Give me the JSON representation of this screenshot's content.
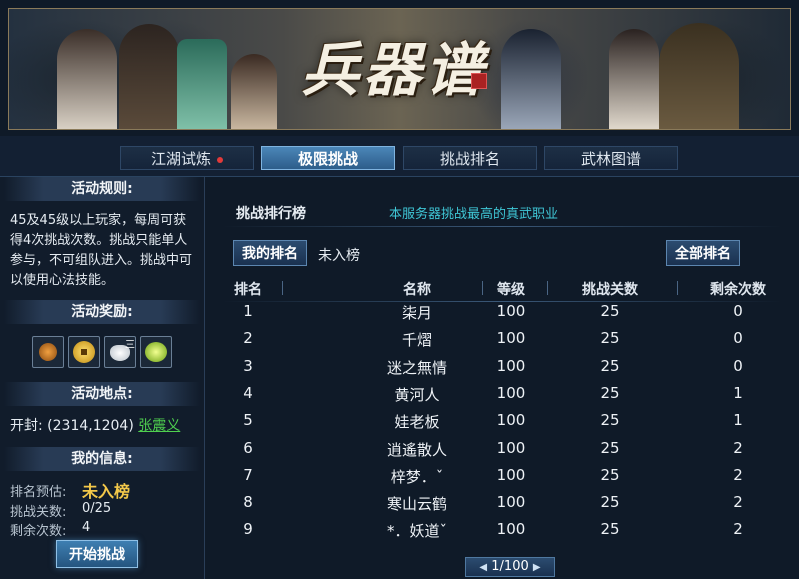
{
  "banner": {
    "title": "兵器谱"
  },
  "tabs": [
    {
      "label": "江湖试炼",
      "has_notice": true
    },
    {
      "label": "极限挑战",
      "active": true
    },
    {
      "label": "挑战排名"
    },
    {
      "label": "武林图谱"
    }
  ],
  "left": {
    "rules_title": "活动规则:",
    "rules_text": "45及45级以上玩家，每周可获得4次挑战次数。挑战只能单人参与，不可组队进入。挑战中可以使用心法技能。",
    "rewards_title": "活动奖励:",
    "reward_icons": [
      "bronze-token-icon",
      "gold-coin-icon",
      "silk-pouch-icon",
      "jade-disc-icon"
    ],
    "reward_badge": "三",
    "location_title": "活动地点:",
    "location_text": "开封: (2314,1204)",
    "location_npc": "张震义",
    "info_title": "我的信息:",
    "info": [
      {
        "label": "排名预估:",
        "value": "未入榜"
      },
      {
        "label": "挑战关数:",
        "value": "0/25"
      },
      {
        "label": "剩余次数:",
        "value": "4"
      }
    ],
    "start_button": "开始挑战"
  },
  "right": {
    "title": "挑战排行榜",
    "subtitle": "本服务器挑战最高的真武职业",
    "my_rank_button": "我的排名",
    "my_rank_value": "未入榜",
    "all_rank_button": "全部排名",
    "columns": [
      "排名",
      "名称",
      "等级",
      "挑战关数",
      "剩余次数"
    ],
    "rows": [
      [
        "1",
        "柒月",
        "100",
        "25",
        "0"
      ],
      [
        "2",
        "千熠",
        "100",
        "25",
        "0"
      ],
      [
        "3",
        "迷之無情",
        "100",
        "25",
        "0"
      ],
      [
        "4",
        "黄河人",
        "100",
        "25",
        "1"
      ],
      [
        "5",
        "娃老板",
        "100",
        "25",
        "1"
      ],
      [
        "6",
        "逍遙散人",
        "100",
        "25",
        "2"
      ],
      [
        "7",
        "梓梦．ˇ",
        "100",
        "25",
        "2"
      ],
      [
        "8",
        "寒山云鹤",
        "100",
        "25",
        "2"
      ],
      [
        "9",
        "*．妖道ˇ",
        "100",
        "25",
        "2"
      ]
    ],
    "pager": "1/100"
  },
  "colors": {
    "accent": "#3fc7d6",
    "gold": "#f3c84a",
    "link": "#4fd04f",
    "notice": "#e23a3a"
  }
}
